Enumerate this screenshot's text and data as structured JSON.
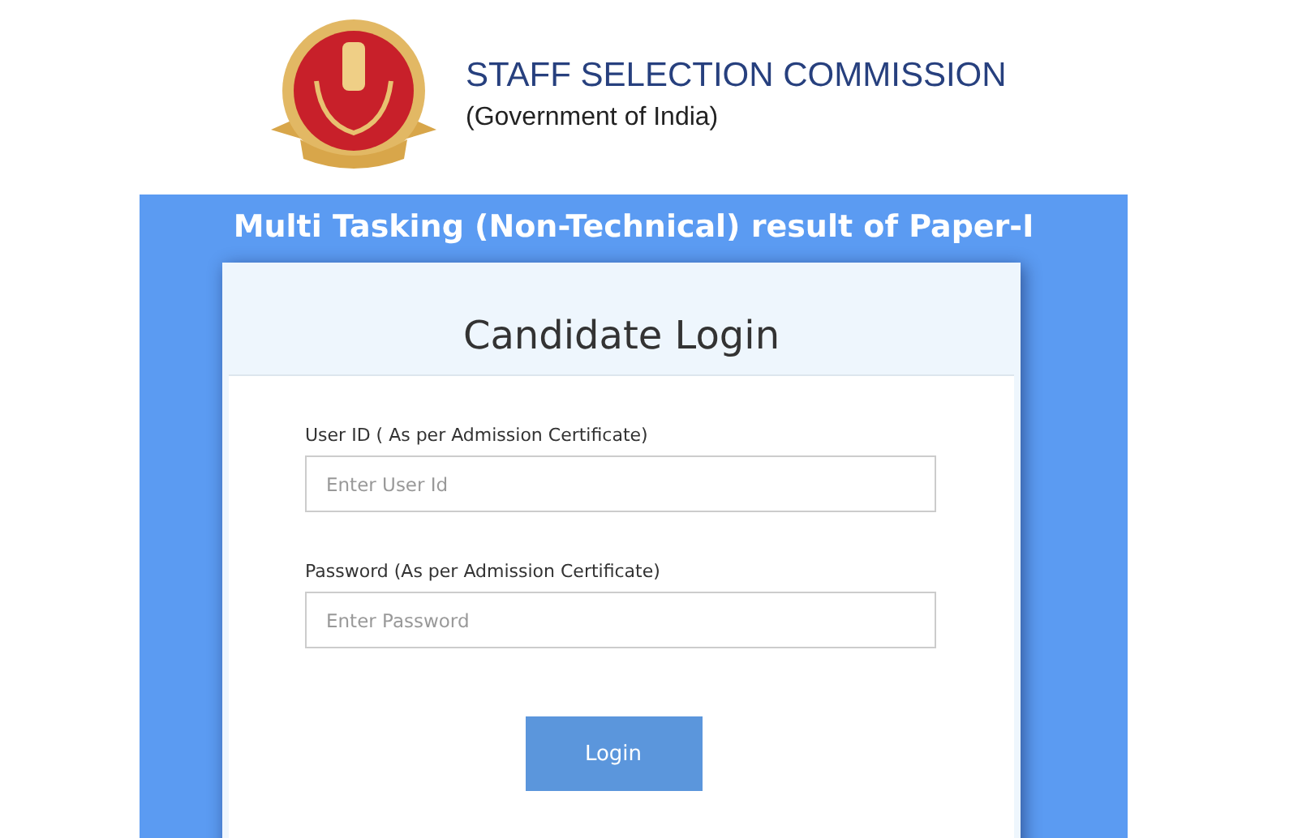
{
  "header": {
    "title": "STAFF SELECTION COMMISSION",
    "subtitle": "(Government of India)"
  },
  "banner": {
    "title": "Multi Tasking (Non-Technical) result of Paper-I"
  },
  "login": {
    "title": "Candidate Login",
    "fields": [
      {
        "label": "User ID ( As per Admission Certificate)",
        "placeholder": "Enter User Id"
      },
      {
        "label": "Password (As per Admission Certificate)",
        "placeholder": "Enter Password"
      }
    ],
    "button": "Login"
  }
}
